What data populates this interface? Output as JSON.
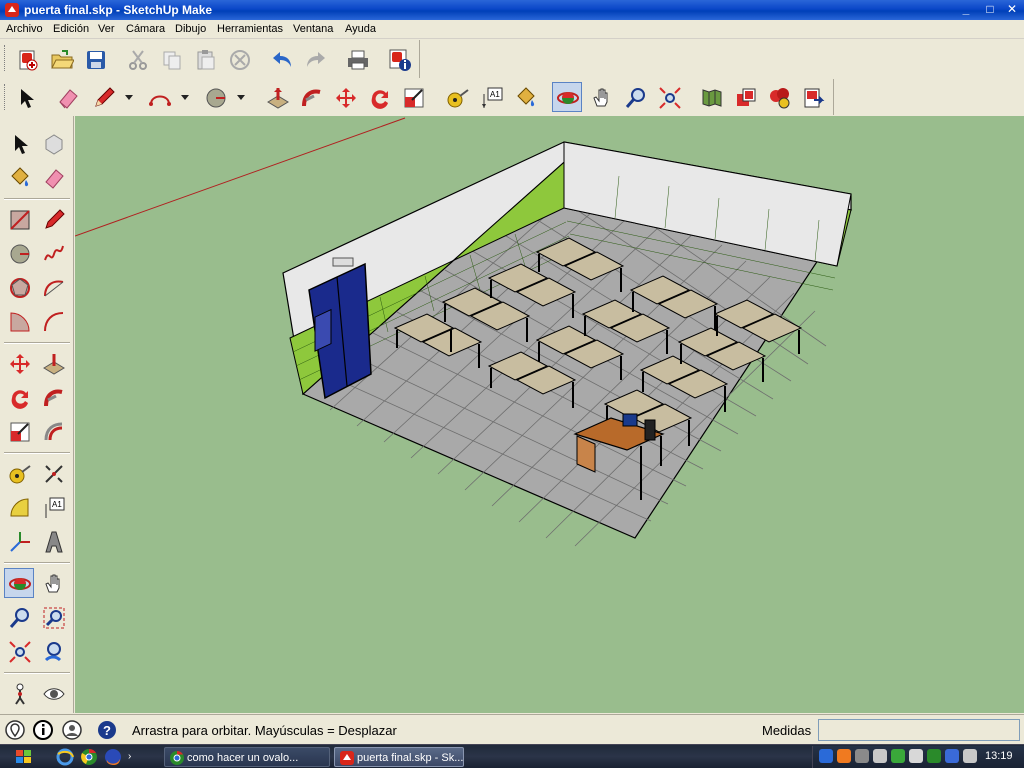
{
  "window": {
    "title": "puerta final.skp - SketchUp Make",
    "controls": {
      "minimize": "_",
      "maximize": "□",
      "close": "✕"
    }
  },
  "menu": [
    "Archivo",
    "Edición",
    "Ver",
    "Cámara",
    "Dibujo",
    "Herramientas",
    "Ventana",
    "Ayuda"
  ],
  "toolbar1": {
    "icons": [
      "new-file-icon",
      "open-folder-icon",
      "save-icon",
      "cut-icon",
      "copy-icon",
      "paste-icon",
      "erase-circle-icon",
      "undo-icon",
      "redo-icon",
      "print-icon",
      "model-info-icon"
    ]
  },
  "toolbar2": {
    "icons": [
      "select-arrow-icon",
      "eraser-icon",
      "pencil-icon",
      "arc-icon",
      "circle-icon",
      "push-pull-icon",
      "follow-me-icon",
      "move-icon",
      "rotate-icon",
      "scale-icon",
      "tape-measure-icon",
      "text-label-icon",
      "paint-bucket-icon",
      "orbit-icon",
      "pan-hand-icon",
      "zoom-icon",
      "zoom-extents-icon",
      "get-models-icon",
      "share-model-icon",
      "extension-warehouse-icon",
      "layout-send-icon"
    ],
    "active": "orbit-icon"
  },
  "left_palette": {
    "icons": [
      "select-icon",
      "make-component-icon",
      "paint-bucket-icon",
      "eraser-icon",
      "rectangle-icon",
      "line-icon",
      "circle-icon",
      "freehand-icon",
      "polygon-icon",
      "arc-icon",
      "pie-icon",
      "two-point-arc-icon",
      "move-icon",
      "push-pull-icon",
      "rotate-icon",
      "follow-me-icon",
      "scale-icon",
      "offset-icon",
      "tape-measure-icon",
      "dimension-icon",
      "protractor-icon",
      "text-icon",
      "axes-icon",
      "3d-text-icon",
      "orbit-icon",
      "pan-icon",
      "zoom-icon",
      "zoom-window-icon",
      "zoom-extents-icon",
      "previous-view-icon",
      "position-camera-icon",
      "look-around-icon"
    ],
    "active": "orbit-icon"
  },
  "status": {
    "text": "Arrastra para orbitar. Mayúsculas = Desplazar",
    "measures_label": "Medidas",
    "measures_value": ""
  },
  "taskbar": {
    "tasks": [
      {
        "label": "como hacer un ovalo...",
        "icon": "chrome-icon"
      },
      {
        "label": "puerta final.skp - Sk...",
        "icon": "sketchup-icon"
      }
    ],
    "clock": "13:19"
  },
  "colors": {
    "viewport_bg": "#99bd8d",
    "floor_tile": "#a9a9a9",
    "wall_white": "#e8e8e8",
    "wall_green_tile": "#8ec83c",
    "door_blue": "#1a2a8c",
    "desk_top": "#c8bda0",
    "teacher_desk": "#b86a2a",
    "orbit_active": "#c6d6ec"
  }
}
